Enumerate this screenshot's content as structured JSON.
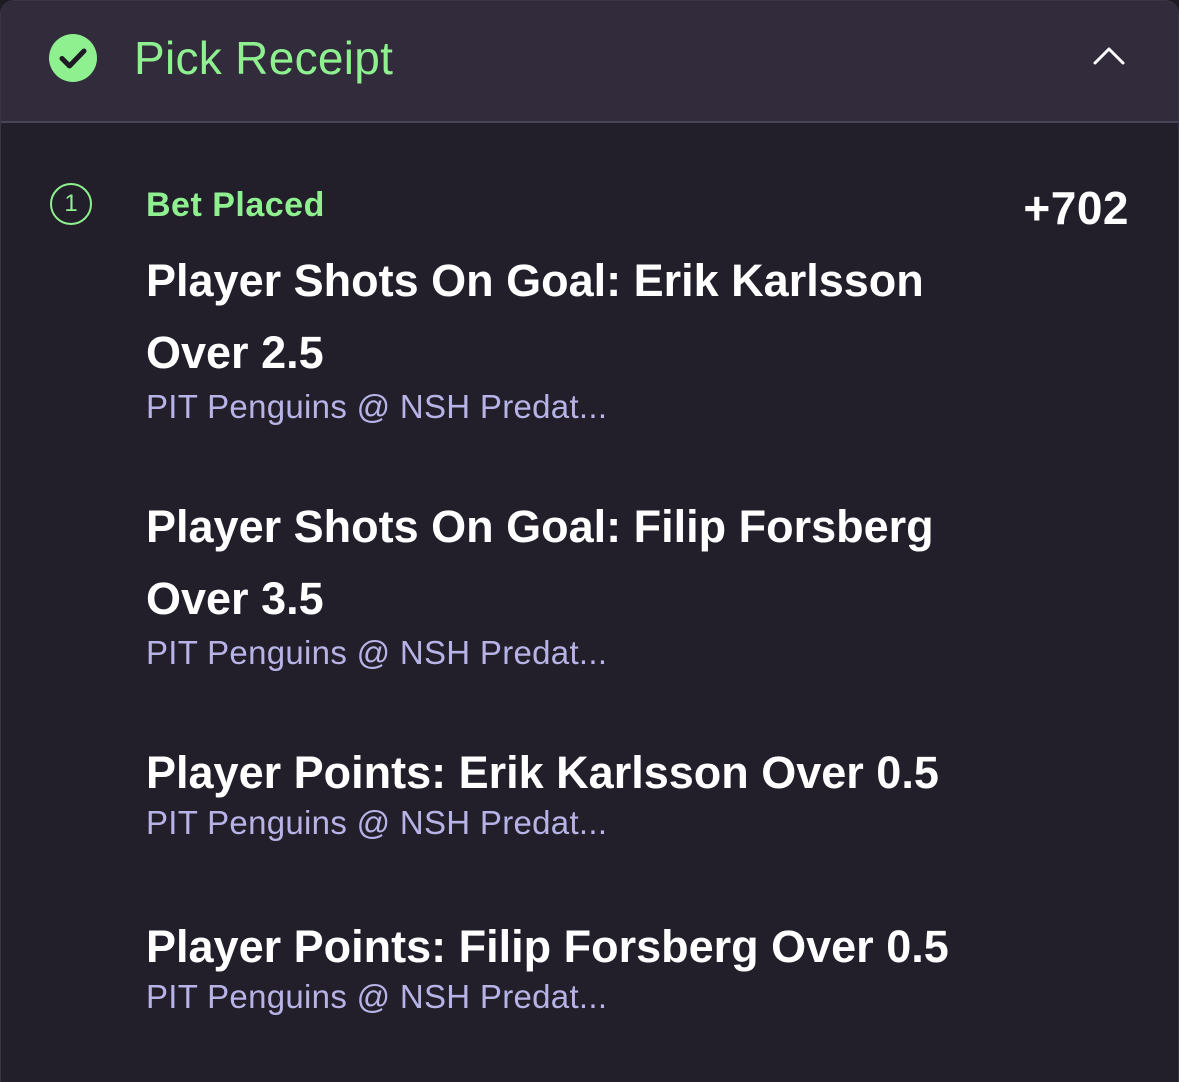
{
  "header": {
    "title": "Pick Receipt",
    "status_icon": "check-circle-icon",
    "collapse_icon": "chevron-up-icon"
  },
  "bet": {
    "step_number": "1",
    "status": "Bet Placed",
    "odds": "+702",
    "picks": [
      {
        "title": "Player Shots On Goal: Erik Karlsson Over 2.5",
        "matchup": "PIT Penguins @ NSH Predat..."
      },
      {
        "title": "Player Shots On Goal: Filip Forsberg Over 3.5",
        "matchup": "PIT Penguins @ NSH Predat..."
      },
      {
        "title": "Player Points: Erik Karlsson Over 0.5",
        "matchup": "PIT Penguins @ NSH Predat..."
      },
      {
        "title": "Player Points: Filip Forsberg Over 0.5",
        "matchup": "PIT Penguins @ NSH Predat..."
      }
    ]
  },
  "colors": {
    "accent_green": "#8ef08f",
    "header_bg": "#312b3b",
    "body_bg": "#221f2a",
    "subtext": "#b7b3e6",
    "text": "#ffffff"
  }
}
